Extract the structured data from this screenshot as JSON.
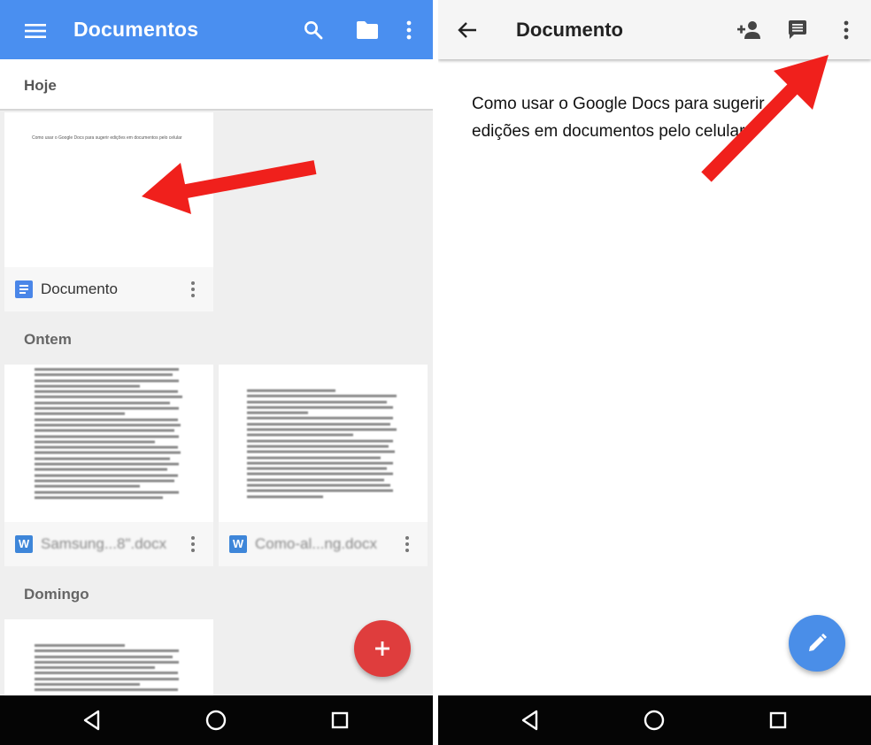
{
  "left": {
    "appbar": {
      "title": "Documentos",
      "icons": [
        "menu-icon",
        "search-icon",
        "folder-icon",
        "more-vert-icon"
      ],
      "color": "#4a8ff0"
    },
    "sections": [
      {
        "label": "Hoje"
      },
      {
        "label": "Ontem"
      },
      {
        "label": "Domingo"
      }
    ],
    "cards": [
      {
        "name": "Documento",
        "icon": "google-doc-icon",
        "preview": "Como usar o Google Docs para sugerir edições em documentos pelo celular"
      },
      {
        "name": "Samsung...8\".docx",
        "icon": "word-doc-icon",
        "icon_letter": "W"
      },
      {
        "name": "Como-al...ng.docx",
        "icon": "word-doc-icon",
        "icon_letter": "W"
      }
    ],
    "fab": {
      "label": "+",
      "color": "#df3d3d",
      "icon": "add-icon"
    }
  },
  "right": {
    "appbar": {
      "title": "Documento",
      "icons": [
        "back-arrow-icon",
        "person-add-icon",
        "comment-icon",
        "more-vert-icon"
      ]
    },
    "body_text": "Como usar o Google Docs para sugerir edições em documentos pelo celular",
    "fab": {
      "color": "#4a8ee8",
      "icon": "pencil-icon"
    }
  },
  "navbar": {
    "icons": [
      "back-triangle-icon",
      "home-circle-icon",
      "recents-square-icon"
    ]
  },
  "annotation_color": "#f0201c"
}
